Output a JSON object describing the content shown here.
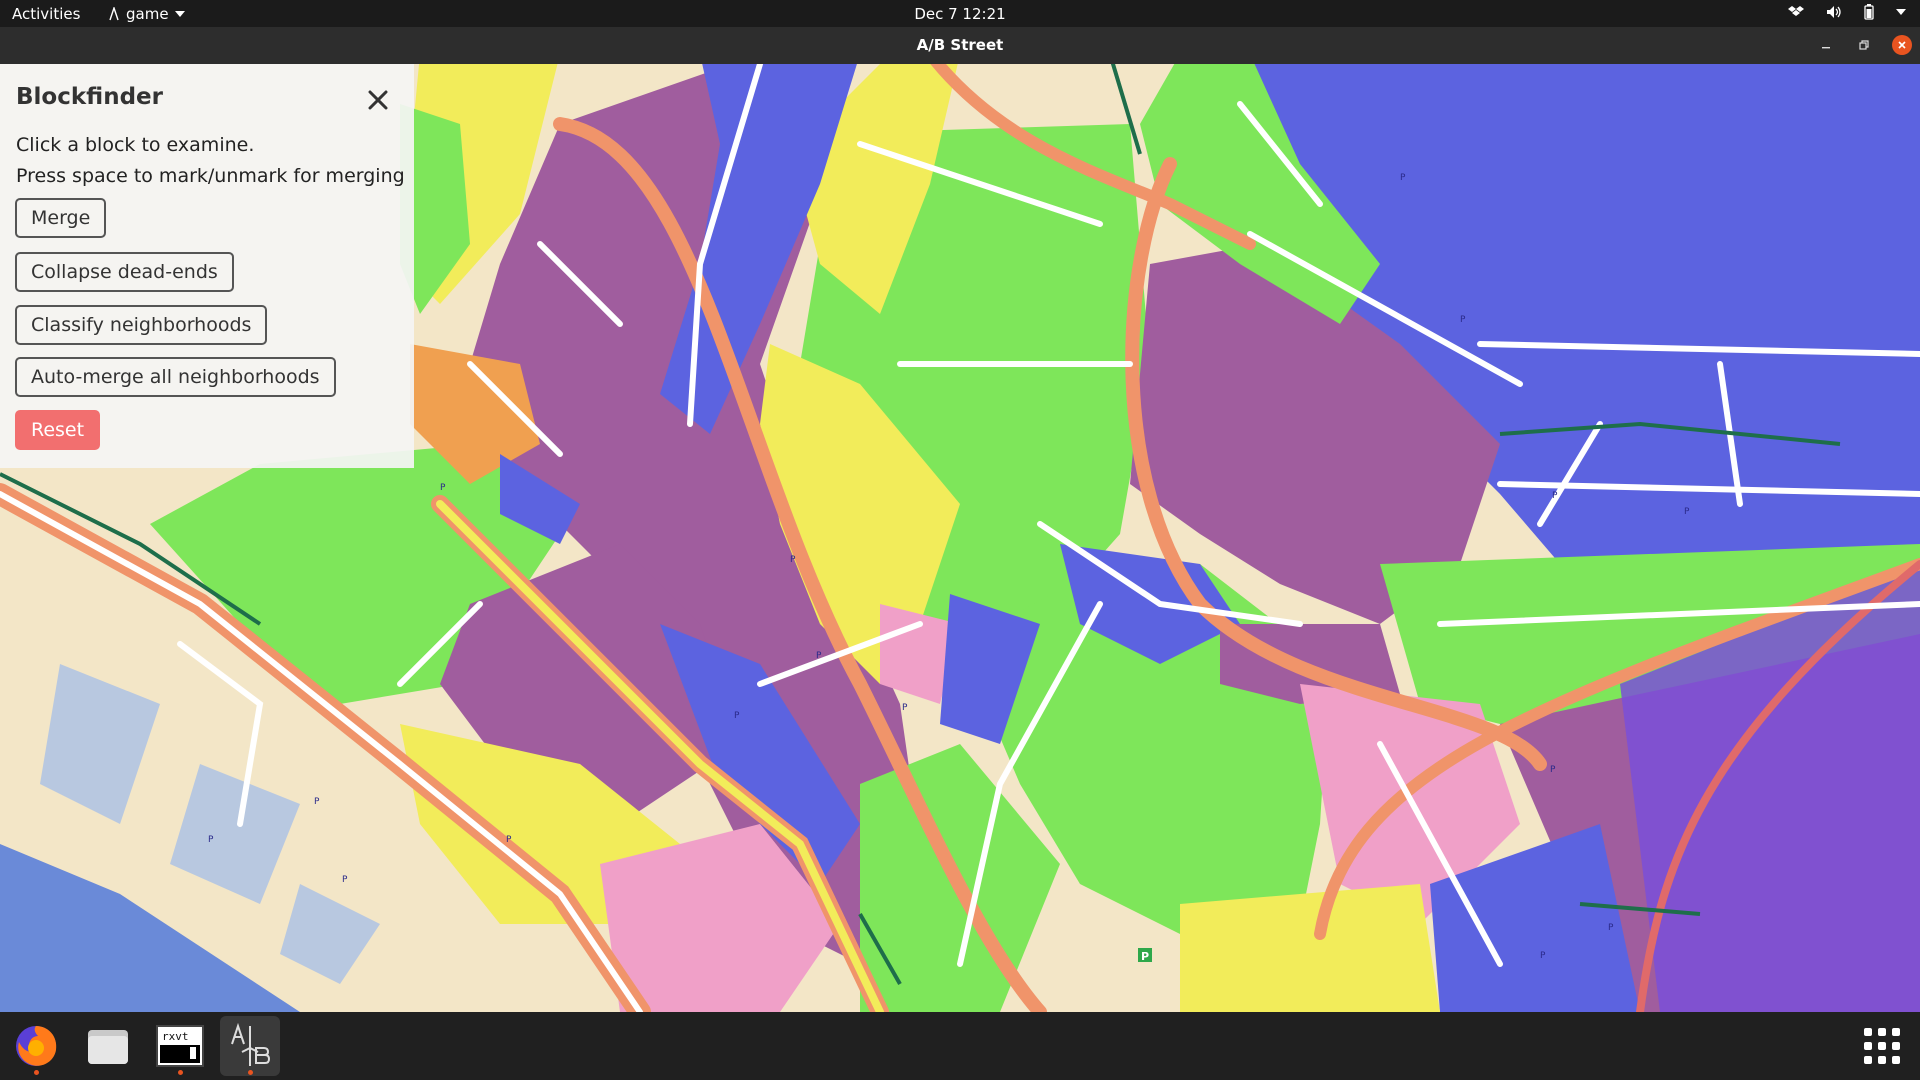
{
  "topbar": {
    "activities": "Activities",
    "app_name": "game",
    "clock": "Dec 7  12:21"
  },
  "window": {
    "title": "A/B Street"
  },
  "panel": {
    "title": "Blockfinder",
    "line1": "Click a block to examine.",
    "line2": "Press space to mark/unmark for merging",
    "buttons": {
      "merge": "Merge",
      "collapse": "Collapse dead-ends",
      "classify": "Classify neighborhoods",
      "automerge": "Auto-merge all neighborhoods",
      "reset": "Reset"
    }
  },
  "taskbar": {
    "apps": [
      "firefox-icon",
      "files-icon",
      "terminal-icon",
      "abstreet-icon"
    ],
    "terminal_label": "rxvt"
  },
  "colors": {
    "accent": "#e95420",
    "reset_button": "#f26f6f",
    "block_purple": "#a05d9e",
    "block_blue": "#5c63e0",
    "block_green": "#7ee65a",
    "block_yellow": "#f2ec5a",
    "block_pink": "#f0a0c8",
    "block_orange": "#f0a050"
  }
}
